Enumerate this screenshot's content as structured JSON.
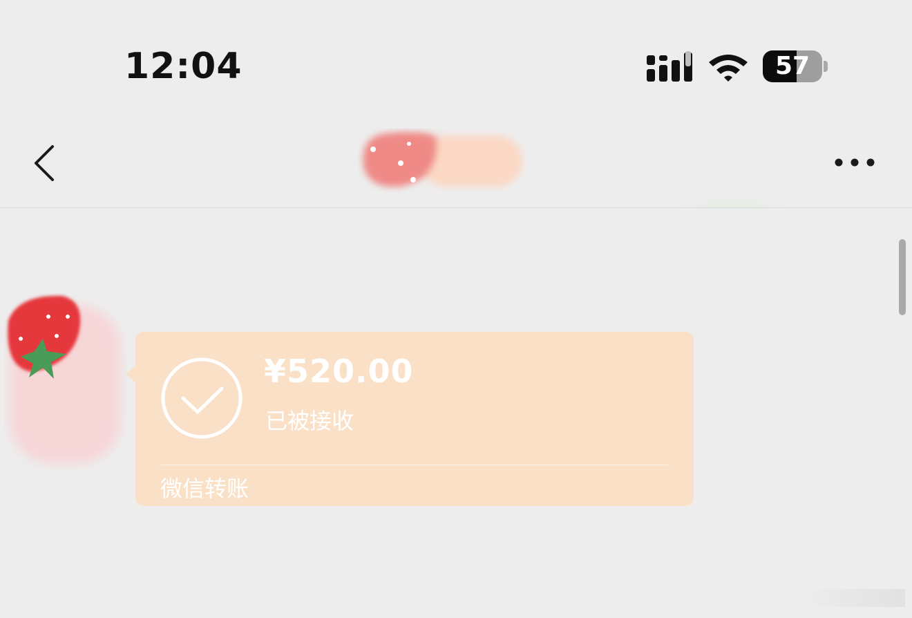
{
  "status_bar": {
    "time": "12:04",
    "battery_level": "57",
    "battery_fraction": 0.57,
    "icons": [
      "signal-icon",
      "wifi-icon",
      "battery-icon"
    ]
  },
  "nav_bar": {
    "icons": [
      "back-icon",
      "contact-avatar-icon",
      "more-icon"
    ]
  },
  "message": {
    "transfer": {
      "amount": "¥520.00",
      "status": "已被接收",
      "footer": "微信转账",
      "icon": "check-circle-icon",
      "bubble_color": "#fae0c6"
    }
  },
  "colors": {
    "background": "#ededed",
    "bubble": "#fae0c6",
    "bubble_text": "#ffffff"
  }
}
